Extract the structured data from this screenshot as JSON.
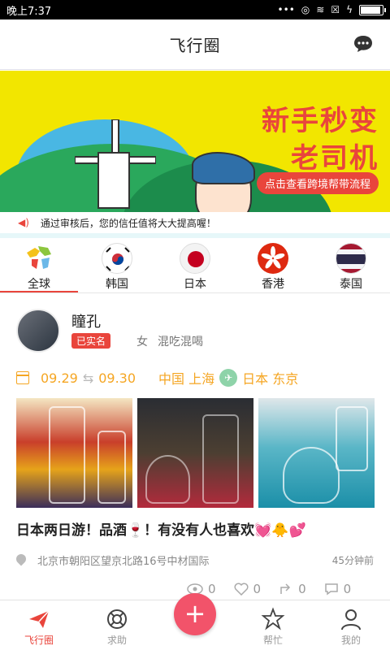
{
  "status": {
    "time": "晚上7:37"
  },
  "header": {
    "title": "飞行圈"
  },
  "banner": {
    "line1": "新手秒变",
    "line2": "老司机",
    "pill": "点击查看跨境帮带流程"
  },
  "notice": {
    "text": "通过审核后，您的信任值将大大提高喔！"
  },
  "regions": [
    {
      "label": "全球",
      "active": true
    },
    {
      "label": "韩国"
    },
    {
      "label": "日本"
    },
    {
      "label": "香港"
    },
    {
      "label": "泰国"
    }
  ],
  "post": {
    "username": "瞳孔",
    "verified": "已实名",
    "gender": "女",
    "tagline": "混吃混喝",
    "date_from": "09.29",
    "date_to": "09.30",
    "from": "中国 上海",
    "to": "日本 东京",
    "title": "日本两日游！品酒🍷！有没有人也喜欢💓🐥💕",
    "address": "北京市朝阳区望京北路16号中材国际",
    "time_ago": "45分钟前",
    "stats": {
      "views": "0",
      "likes": "0",
      "shares": "0",
      "comments": "0"
    }
  },
  "bottom_nav": {
    "items": [
      "飞行圈",
      "求助",
      "+",
      "帮忙",
      "我的"
    ],
    "fab": "+"
  }
}
